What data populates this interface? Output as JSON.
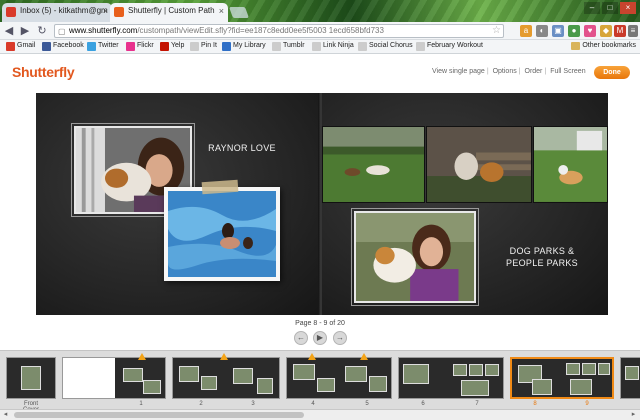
{
  "browser": {
    "tabs": [
      {
        "title": "Inbox (5) - kitkathm@gm"
      },
      {
        "title": "Shutterfly | Custom Path"
      }
    ],
    "url_host": "www.shutterfly.com",
    "url_path": "/custompath/viewEdit.sfly?fid=ee187c8edd0ee5f5003 1ecd658bfd733",
    "bookmarks": [
      {
        "label": "Gmail",
        "color": "#d93a2a"
      },
      {
        "label": "Facebook",
        "color": "#3b5998"
      },
      {
        "label": "Twitter",
        "color": "#3aa1e0"
      },
      {
        "label": "Flickr",
        "color": "#e8318d"
      },
      {
        "label": "Yelp",
        "color": "#c41200"
      },
      {
        "label": "Pin It",
        "color": "#cccccc"
      },
      {
        "label": "My Library",
        "color": "#2f6fc7"
      },
      {
        "label": "Tumblr",
        "color": "#cccccc"
      },
      {
        "label": "Link Ninja",
        "color": "#cccccc"
      },
      {
        "label": "Social Chorus",
        "color": "#cccccc"
      },
      {
        "label": "February Workout",
        "color": "#cccccc"
      }
    ],
    "other_bookmarks": "Other bookmarks"
  },
  "header": {
    "logo": "Shutterfly",
    "links": [
      "View single page",
      "Options",
      "Order",
      "Full Screen"
    ],
    "done_label": "Done",
    "accent": "#e8760a"
  },
  "book": {
    "left_caption": "RAYNOR LOVE",
    "right_caption_line1": "DOG PARKS &",
    "right_caption_line2": "PEOPLE PARKS"
  },
  "pagination": {
    "label": "Page 8 - 9 of 20",
    "prev_icon": "arrow-left-icon",
    "play_icon": "play-icon",
    "next_icon": "arrow-right-icon"
  },
  "filmstrip": {
    "labels": [
      "Front Cover",
      "1",
      "2",
      "3",
      "4",
      "5",
      "6",
      "7",
      "8",
      "9"
    ]
  }
}
